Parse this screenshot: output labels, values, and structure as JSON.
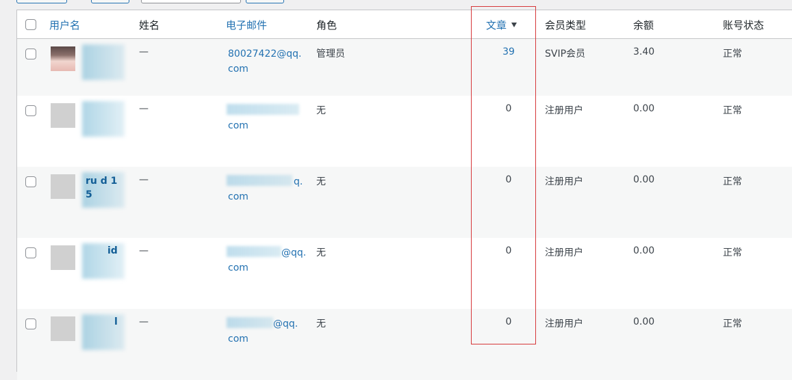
{
  "columns": {
    "username": "用户名",
    "name": "姓名",
    "email": "电子邮件",
    "role": "角色",
    "posts": "文章",
    "member_type": "会员类型",
    "balance": "余额",
    "status": "账号状态"
  },
  "rows": [
    {
      "username_frag": "",
      "name": "—",
      "email_line1": "80027422@qq.",
      "email_line2": "com",
      "role": "管理员",
      "posts": "39",
      "member_type": "SVIP会员",
      "balance": "3.40",
      "status": "正常"
    },
    {
      "username_frag": "",
      "name": "—",
      "email_line1": "",
      "email_line2": "com",
      "role": "无",
      "posts": "0",
      "member_type": "注册用户",
      "balance": "0.00",
      "status": "正常"
    },
    {
      "username_frag": "ru d 1 5",
      "name": "—",
      "email_line1": "q.",
      "email_line2": "com",
      "role": "无",
      "posts": "0",
      "member_type": "注册用户",
      "balance": "0.00",
      "status": "正常"
    },
    {
      "username_frag": "id",
      "name": "—",
      "email_line1": "@qq.",
      "email_line2": "com",
      "role": "无",
      "posts": "0",
      "member_type": "注册用户",
      "balance": "0.00",
      "status": "正常"
    },
    {
      "username_frag": "l",
      "name": "—",
      "email_line1": "@qq.",
      "email_line2": "com",
      "role": "无",
      "posts": "0",
      "member_type": "注册用户",
      "balance": "0.00",
      "status": "正常"
    }
  ],
  "colors": {
    "link": "#2271b1",
    "highlight": "#d63638"
  }
}
